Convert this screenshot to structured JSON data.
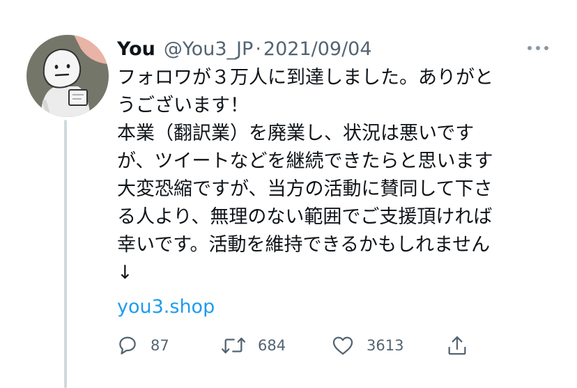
{
  "tweet": {
    "author_name": "You",
    "handle": "@You3_JP",
    "separator": "·",
    "date": "2021/09/04",
    "avatar_icon": "cartoon-face-avatar",
    "more_icon": "more-horizontal-icon",
    "text_lines": [
      "フォロワが３万人に到達しました。ありがと",
      "うございます！",
      "本業（翻訳業）を廃業し、状況は悪いです",
      "が、ツイートなどを継続できたらと思います",
      "大変恐縮ですが、当方の活動に賛同して下さ",
      "る人より、無理のない範囲でご支援頂ければ",
      "幸いです。活動を維持できるかもしれません",
      "↓"
    ],
    "link": "you3.shop",
    "link_color": "#1d9bf0"
  },
  "actions": {
    "reply_count": "87",
    "retweet_count": "684",
    "like_count": "3613",
    "icons": [
      "reply-icon",
      "retweet-icon",
      "like-icon",
      "share-icon"
    ]
  }
}
